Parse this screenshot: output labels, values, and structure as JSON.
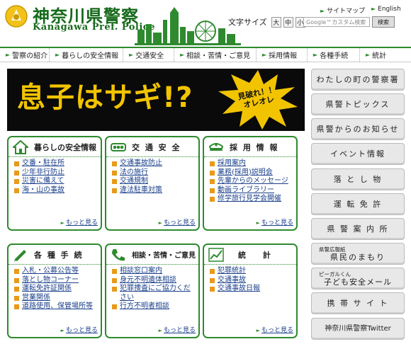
{
  "header": {
    "logo_ja": "神奈川県警察",
    "logo_en": "Kanagawa Pref. Police",
    "sitemap_label": "サイトマップ",
    "english_label": "English",
    "fontsize_label": "文字サイズ",
    "fontsize_large": "大",
    "fontsize_medium": "中",
    "fontsize_small": "小",
    "search_placeholder": "Google™カスタム検索",
    "search_button": "検索"
  },
  "nav": [
    "警察の紹介",
    "暮らしの安全情報",
    "交通安全",
    "相談・苦情・ご意見",
    "採用情報",
    "各種手続",
    "統計"
  ],
  "banner": {
    "text": "息子はサギ!?",
    "burst_text": "見破れ！！\nオレオレ"
  },
  "panels": [
    {
      "title": "暮らしの安全情報",
      "icon": "house-icon",
      "links": [
        "交番・駐在所",
        "少年非行防止",
        "災害に備えて",
        "海・山の事故"
      ],
      "more": "もっと見る"
    },
    {
      "title": "交 通 安 全",
      "icon": "traffic-light-icon",
      "links": [
        "交通事故防止",
        "法の施行",
        "交通規制",
        "違法駐車対策"
      ],
      "more": "もっと見る"
    },
    {
      "title": "採 用 情 報",
      "icon": "police-cap-icon",
      "links": [
        "採用案内",
        "業務(採用)説明会",
        "先輩からのメッセージ",
        "動画ライブラリー",
        "修学旅行見学会開催"
      ],
      "more": "もっと見る"
    },
    {
      "title": "各 種 手 続",
      "icon": "pencil-icon",
      "links": [
        "入札・公募公告等",
        "落とし物コーナー",
        "運転免許証関係",
        "営業関係",
        "道路使用、保管場所等"
      ],
      "more": "もっと見る"
    },
    {
      "title": "相談・苦情・ご意見",
      "icon": "phone-icon",
      "links": [
        "相談窓口案内",
        "身元不明遺体相談",
        "犯罪捜査にご協力ください",
        "行方不明者相談"
      ],
      "more": "もっと見る"
    },
    {
      "title": "統 計",
      "icon": "chart-icon",
      "links": [
        "犯罪統計",
        "交通事故",
        "交通事故日報"
      ],
      "more": "もっと見る"
    }
  ],
  "side_buttons": [
    {
      "main": "わたしの町の警察署",
      "sub": ""
    },
    {
      "main": "県警トピックス",
      "sub": ""
    },
    {
      "main": "県警からのお知らせ",
      "sub": ""
    },
    {
      "main": "イベント情報",
      "sub": ""
    },
    {
      "main": "落 と し 物",
      "sub": ""
    },
    {
      "main": "運 転 免 許",
      "sub": ""
    },
    {
      "main": "県 警 案 内 所",
      "sub": ""
    },
    {
      "main": "県民のまもり",
      "sub": "県警広報紙"
    },
    {
      "main": "子ども安全メール",
      "sub": "ピーガルくん"
    },
    {
      "main": "携 帯 サ イ ト",
      "sub": ""
    },
    {
      "main": "神奈川県警察Twitter",
      "sub": ""
    }
  ],
  "colors": {
    "brand_green": "#2f8a2f",
    "banner_bg": "#0a0a0a",
    "banner_text": "#f2c400",
    "bullet": "#e89a1a"
  }
}
